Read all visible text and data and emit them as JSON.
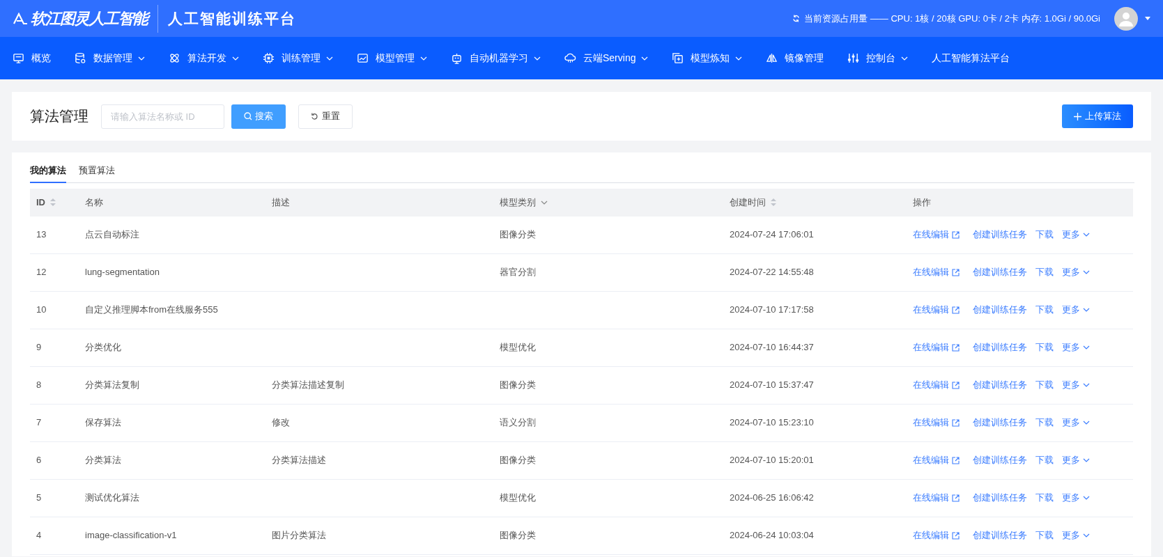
{
  "header": {
    "logo": "软江图灵人工智能",
    "title": "人工智能训练平台",
    "resources": "当前资源占用量 —— CPU: 1核 / 20核 GPU: 0卡 / 2卡 内存: 1.0Gi / 90.0Gi"
  },
  "nav": [
    {
      "label": "概览",
      "dropdown": false
    },
    {
      "label": "数据管理",
      "dropdown": true
    },
    {
      "label": "算法开发",
      "dropdown": true
    },
    {
      "label": "训练管理",
      "dropdown": true
    },
    {
      "label": "模型管理",
      "dropdown": true
    },
    {
      "label": "自动机器学习",
      "dropdown": true
    },
    {
      "label": "云端Serving",
      "dropdown": true
    },
    {
      "label": "模型炼知",
      "dropdown": true
    },
    {
      "label": "镜像管理",
      "dropdown": false
    },
    {
      "label": "控制台",
      "dropdown": true
    },
    {
      "label": "人工智能算法平台",
      "dropdown": false
    }
  ],
  "toolbar": {
    "title": "算法管理",
    "search": {
      "placeholder": "请输入算法名称或 ID"
    },
    "search_button": "搜索",
    "reset_button": "重置",
    "upload_button": "上传算法"
  },
  "tabs": [
    {
      "label": "我的算法",
      "selected": true
    },
    {
      "label": "预置算法",
      "selected": false
    }
  ],
  "table": {
    "columns": [
      "ID",
      "名称",
      "描述",
      "模型类别",
      "创建时间",
      "操作"
    ],
    "rows": [
      {
        "id": "13",
        "name": "点云自动标注",
        "category": "图像分类",
        "created": "2024-07-24 17:06:01",
        "actions": [
          "在线编辑",
          "创建训练任务",
          "下载",
          "更多"
        ]
      },
      {
        "id": "12",
        "name": "lung-segmentation",
        "category": "器官分割",
        "created": "2024-07-22 14:55:48",
        "actions": [
          "在线编辑",
          "创建训练任务",
          "下载",
          "更多"
        ]
      },
      {
        "id": "10",
        "name": "自定义推理脚本from在线服务555",
        "created": "2024-07-10 17:17:58",
        "actions": [
          "在线编辑",
          "创建训练任务",
          "下载",
          "更多"
        ]
      },
      {
        "id": "9",
        "name": "分类优化",
        "category": "模型优化",
        "created": "2024-07-10 16:44:37",
        "actions": [
          "在线编辑",
          "创建训练任务",
          "下载",
          "更多"
        ]
      },
      {
        "id": "8",
        "name": "分类算法复制",
        "description": "分类算法描述复制",
        "category": "图像分类",
        "created": "2024-07-10 15:37:47",
        "actions": [
          "在线编辑",
          "创建训练任务",
          "下载",
          "更多"
        ]
      },
      {
        "id": "7",
        "name": "保存算法",
        "description": "修改",
        "category": "语义分割",
        "created": "2024-07-10 15:23:10",
        "actions": [
          "在线编辑",
          "创建训练任务",
          "下载",
          "更多"
        ]
      },
      {
        "id": "6",
        "name": "分类算法",
        "description": "分类算法描述",
        "category": "图像分类",
        "created": "2024-07-10 15:20:01",
        "actions": [
          "在线编辑",
          "创建训练任务",
          "下载",
          "更多"
        ]
      },
      {
        "id": "5",
        "name": "测试优化算法",
        "category": "模型优化",
        "created": "2024-06-25 16:06:42",
        "actions": [
          "在线编辑",
          "创建训练任务",
          "下载",
          "更多"
        ]
      },
      {
        "id": "4",
        "name": "image-classification-v1",
        "description": "图片分类算法",
        "category": "图像分类",
        "created": "2024-06-24 10:03:04",
        "actions": [
          "在线编辑",
          "创建训练任务",
          "下载",
          "更多"
        ]
      }
    ]
  }
}
